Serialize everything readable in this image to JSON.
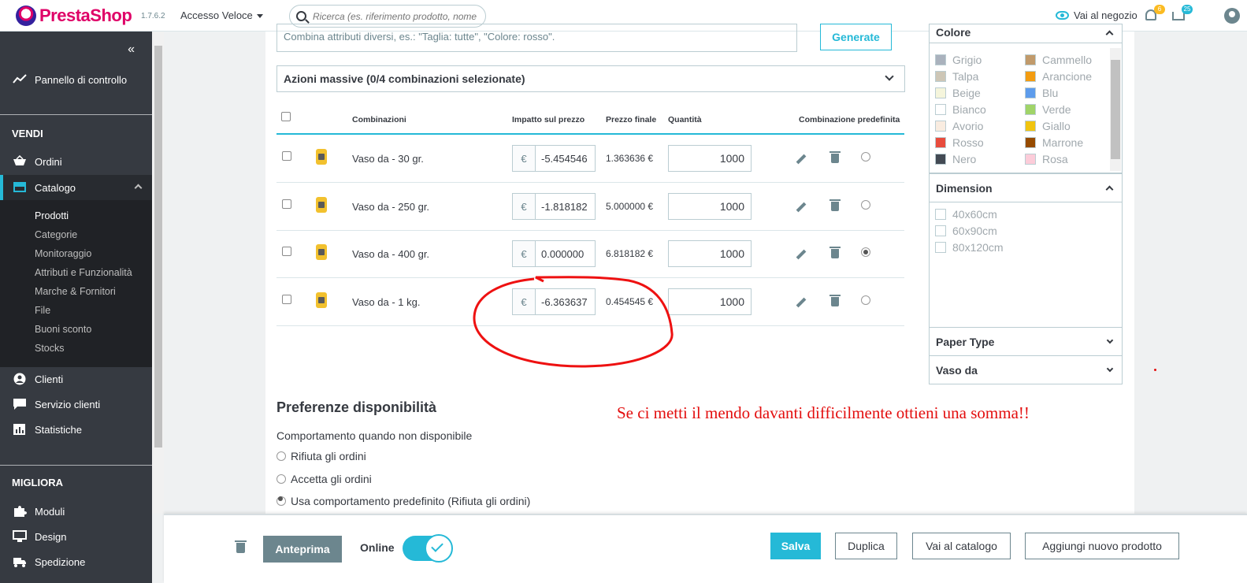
{
  "topbar": {
    "logo_presta": "Presta",
    "logo_shop": "Shop",
    "version": "1.7.6.2",
    "quick_access": "Accesso Veloce",
    "search_placeholder": "Ricerca (es. riferimento prodotto, nome",
    "shop_link": "Vai al negozio",
    "orders_badge": "6",
    "customers_badge": "25"
  },
  "sidebar": {
    "dashboard": "Pannello di controllo",
    "section_sell": "VENDI",
    "orders": "Ordini",
    "catalog": "Catalogo",
    "catalog_sub": [
      "Prodotti",
      "Categorie",
      "Monitoraggio",
      "Attributi e Funzionalità",
      "Marche & Fornitori",
      "File",
      "Buoni sconto",
      "Stocks"
    ],
    "customers": "Clienti",
    "customer_service": "Servizio clienti",
    "stats": "Statistiche",
    "section_improve": "MIGLIORA",
    "modules": "Moduli",
    "design": "Design",
    "shipping": "Spedizione"
  },
  "generator": {
    "placeholder": "Combina attributi diversi, es.: \"Taglia: tutte\", \"Colore: rosso\".",
    "button": "Generate"
  },
  "bulk_actions": "Azioni massive (0/4 combinazioni selezionate)",
  "table": {
    "headers": {
      "combinations": "Combinazioni",
      "price_impact": "Impatto sul prezzo",
      "final_price": "Prezzo finale",
      "quantity": "Quantità",
      "default": "Combinazione predefinita"
    },
    "currency": "€",
    "rows": [
      {
        "name": "Vaso da - 30 gr.",
        "impact": "-5.454546",
        "final": "1.363636 €",
        "qty": "1000",
        "default": false
      },
      {
        "name": "Vaso da - 250 gr.",
        "impact": "-1.818182",
        "final": "5.000000 €",
        "qty": "1000",
        "default": false
      },
      {
        "name": "Vaso da - 400 gr.",
        "impact": "0.000000",
        "final": "6.818182 €",
        "qty": "1000",
        "default": true
      },
      {
        "name": "Vaso da - 1 kg.",
        "impact": "-6.363637",
        "final": "0.454545 €",
        "qty": "1000",
        "default": false
      }
    ]
  },
  "filters": {
    "color_title": "Colore",
    "colors_left": [
      {
        "name": "Grigio",
        "hex": "#aab2bd"
      },
      {
        "name": "Talpa",
        "hex": "#cdc6b6"
      },
      {
        "name": "Beige",
        "hex": "#f5f5dc"
      },
      {
        "name": "Bianco",
        "hex": "#ffffff"
      },
      {
        "name": "Avorio",
        "hex": "#f9ece0"
      },
      {
        "name": "Rosso",
        "hex": "#e84c3d"
      },
      {
        "name": "Nero",
        "hex": "#434a54"
      }
    ],
    "colors_right": [
      {
        "name": "Cammello",
        "hex": "#c19a6b"
      },
      {
        "name": "Arancione",
        "hex": "#f39c11"
      },
      {
        "name": "Blu",
        "hex": "#5d9cec"
      },
      {
        "name": "Verde",
        "hex": "#a0d468"
      },
      {
        "name": "Giallo",
        "hex": "#f1c40f"
      },
      {
        "name": "Marrone",
        "hex": "#964b00"
      },
      {
        "name": "Rosa",
        "hex": "#fcccd9"
      }
    ],
    "dimension_title": "Dimension",
    "dimensions": [
      "40x60cm",
      "60x90cm",
      "80x120cm"
    ],
    "paper_type": "Paper Type",
    "vaso_da": "Vaso da"
  },
  "availability": {
    "title": "Preferenze disponibilità",
    "subtitle": "Comportamento quando non disponibile",
    "options": [
      "Rifiuta gli ordini",
      "Accetta gli ordini",
      "Usa comportamento predefinito (Rifiuta gli ordini)"
    ],
    "selected": 2
  },
  "annotation": "Se ci metti il mendo davanti difficilmente ottieni una somma!!",
  "footer": {
    "preview": "Anteprima",
    "online": "Online",
    "online_state": true,
    "save": "Salva",
    "duplicate": "Duplica",
    "to_catalog": "Vai al catalogo",
    "add_product": "Aggiungi nuovo prodotto"
  }
}
